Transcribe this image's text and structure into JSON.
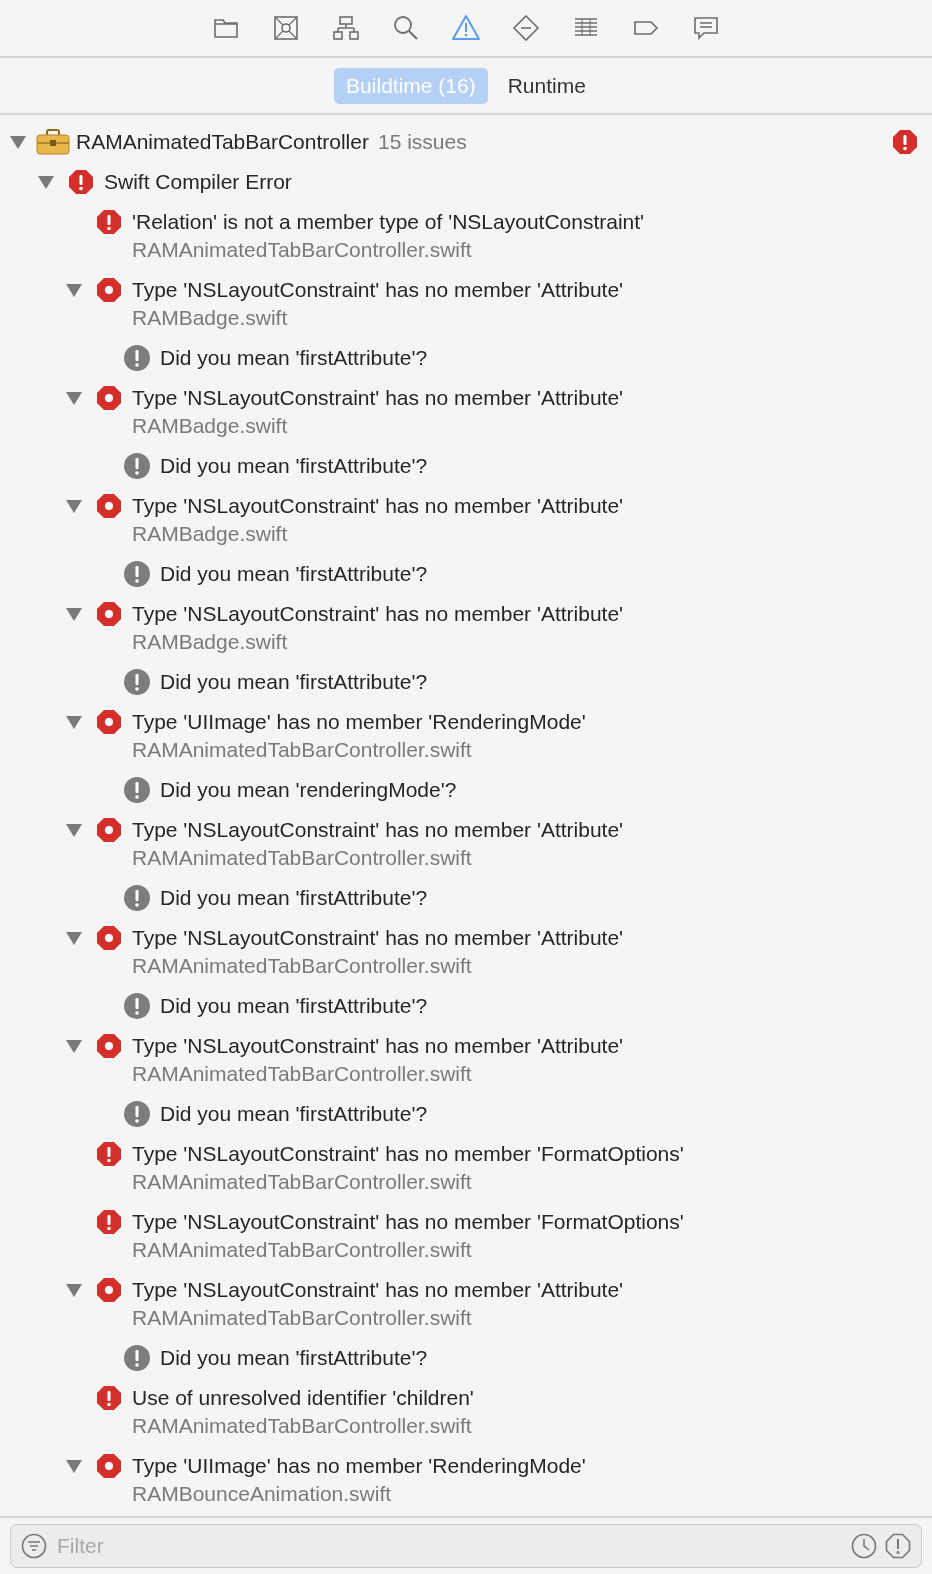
{
  "toolbar": [
    {
      "kind": "folder",
      "selected": false
    },
    {
      "kind": "source",
      "selected": false
    },
    {
      "kind": "hierarchy",
      "selected": false
    },
    {
      "kind": "search",
      "selected": false
    },
    {
      "kind": "issues",
      "selected": true
    },
    {
      "kind": "tests",
      "selected": false
    },
    {
      "kind": "debug",
      "selected": false
    },
    {
      "kind": "breakpoints",
      "selected": false
    },
    {
      "kind": "reports",
      "selected": false
    }
  ],
  "tabs": [
    {
      "label": "Buildtime (16)",
      "selected": true
    },
    {
      "label": "Runtime",
      "selected": false
    }
  ],
  "issues": [
    {
      "kind": "project",
      "title": "RAMAnimatedTabBarController",
      "count": "15 issues",
      "expanded": true,
      "children": [
        {
          "kind": "group",
          "title": "Swift Compiler Error",
          "expanded": true,
          "children": [
            {
              "kind": "error",
              "title": "'Relation' is not a member type of 'NSLayoutConstraint'",
              "file": "RAMAnimatedTabBarController.swift"
            },
            {
              "kind": "fixit",
              "title": "Type 'NSLayoutConstraint' has no member 'Attribute'",
              "file": "RAMBadge.swift",
              "expanded": true,
              "children": [
                {
                  "kind": "note",
                  "title": "Did you mean 'firstAttribute'?"
                }
              ]
            },
            {
              "kind": "fixit",
              "title": "Type 'NSLayoutConstraint' has no member 'Attribute'",
              "file": "RAMBadge.swift",
              "expanded": true,
              "children": [
                {
                  "kind": "note",
                  "title": "Did you mean 'firstAttribute'?"
                }
              ]
            },
            {
              "kind": "fixit",
              "title": "Type 'NSLayoutConstraint' has no member 'Attribute'",
              "file": "RAMBadge.swift",
              "expanded": true,
              "children": [
                {
                  "kind": "note",
                  "title": "Did you mean 'firstAttribute'?"
                }
              ]
            },
            {
              "kind": "fixit",
              "title": "Type 'NSLayoutConstraint' has no member 'Attribute'",
              "file": "RAMBadge.swift",
              "expanded": true,
              "children": [
                {
                  "kind": "note",
                  "title": "Did you mean 'firstAttribute'?"
                }
              ]
            },
            {
              "kind": "fixit",
              "title": "Type 'UIImage' has no member 'RenderingMode'",
              "file": "RAMAnimatedTabBarController.swift",
              "expanded": true,
              "children": [
                {
                  "kind": "note",
                  "title": "Did you mean 'renderingMode'?"
                }
              ]
            },
            {
              "kind": "fixit",
              "title": "Type 'NSLayoutConstraint' has no member 'Attribute'",
              "file": "RAMAnimatedTabBarController.swift",
              "expanded": true,
              "children": [
                {
                  "kind": "note",
                  "title": "Did you mean 'firstAttribute'?"
                }
              ]
            },
            {
              "kind": "fixit",
              "title": "Type 'NSLayoutConstraint' has no member 'Attribute'",
              "file": "RAMAnimatedTabBarController.swift",
              "expanded": true,
              "children": [
                {
                  "kind": "note",
                  "title": "Did you mean 'firstAttribute'?"
                }
              ]
            },
            {
              "kind": "fixit",
              "title": "Type 'NSLayoutConstraint' has no member 'Attribute'",
              "file": "RAMAnimatedTabBarController.swift",
              "expanded": true,
              "children": [
                {
                  "kind": "note",
                  "title": "Did you mean 'firstAttribute'?"
                }
              ]
            },
            {
              "kind": "error",
              "title": "Type 'NSLayoutConstraint' has no member 'FormatOptions'",
              "file": "RAMAnimatedTabBarController.swift"
            },
            {
              "kind": "error",
              "title": "Type 'NSLayoutConstraint' has no member 'FormatOptions'",
              "file": "RAMAnimatedTabBarController.swift"
            },
            {
              "kind": "fixit",
              "title": "Type 'NSLayoutConstraint' has no member 'Attribute'",
              "file": "RAMAnimatedTabBarController.swift",
              "expanded": true,
              "children": [
                {
                  "kind": "note",
                  "title": "Did you mean 'firstAttribute'?"
                }
              ]
            },
            {
              "kind": "error",
              "title": "Use of unresolved identifier 'children'",
              "file": "RAMAnimatedTabBarController.swift"
            },
            {
              "kind": "fixit",
              "title": "Type 'UIImage' has no member 'RenderingMode'",
              "file": "RAMBounceAnimation.swift",
              "expanded": true
            }
          ]
        }
      ]
    }
  ],
  "filter": {
    "placeholder": "Filter"
  }
}
